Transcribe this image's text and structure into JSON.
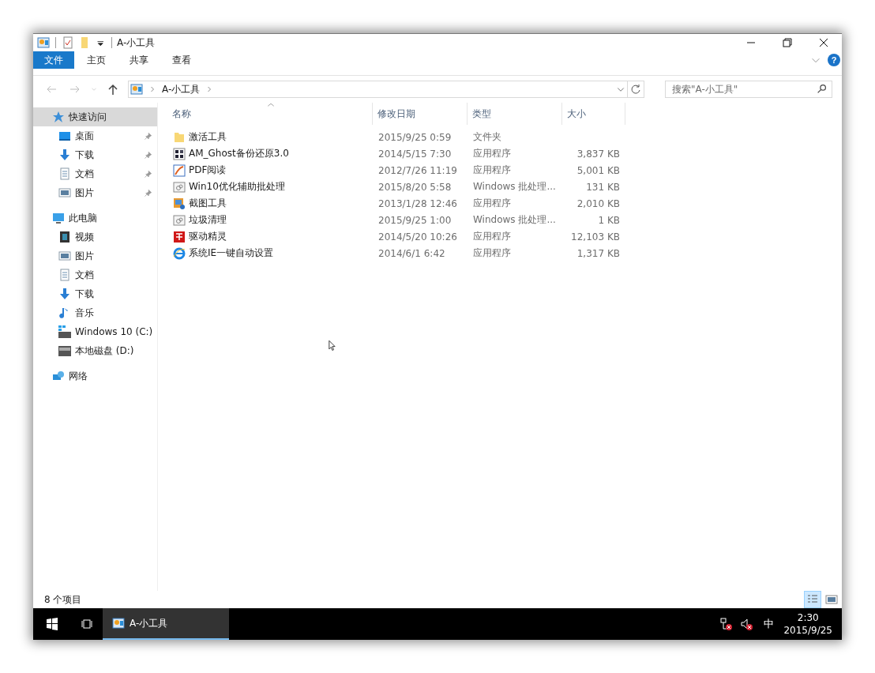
{
  "window": {
    "title": "A-小工具"
  },
  "ribbon_tabs": [
    {
      "label": "文件",
      "selected": true
    },
    {
      "label": "主页",
      "selected": false
    },
    {
      "label": "共享",
      "selected": false
    },
    {
      "label": "查看",
      "selected": false
    }
  ],
  "address": {
    "path": [
      "A-小工具"
    ]
  },
  "search": {
    "placeholder": "搜索\"A-小工具\""
  },
  "help": "?",
  "sidebar": {
    "items": [
      {
        "label": "快速访问",
        "kind": "star",
        "selected": true,
        "children": [
          {
            "label": "桌面",
            "kind": "desktop",
            "selected": false,
            "pinned": true
          },
          {
            "label": "下载",
            "kind": "download",
            "selected": false,
            "pinned": true
          },
          {
            "label": "文档",
            "kind": "document",
            "selected": false,
            "pinned": true
          },
          {
            "label": "图片",
            "kind": "picture",
            "selected": false,
            "pinned": true
          }
        ]
      },
      {
        "label": "此电脑",
        "kind": "pc",
        "selected": false,
        "children": [
          {
            "label": "视频",
            "kind": "video",
            "selected": false,
            "pinned": false
          },
          {
            "label": "图片",
            "kind": "picture",
            "selected": false,
            "pinned": false
          },
          {
            "label": "文档",
            "kind": "document",
            "selected": false,
            "pinned": false
          },
          {
            "label": "下载",
            "kind": "download",
            "selected": false,
            "pinned": false
          },
          {
            "label": "音乐",
            "kind": "music",
            "selected": false,
            "pinned": false
          },
          {
            "label": "Windows 10 (C:)",
            "kind": "drive-win",
            "selected": false,
            "pinned": false
          },
          {
            "label": "本地磁盘 (D:)",
            "kind": "drive",
            "selected": false,
            "pinned": false
          }
        ]
      },
      {
        "label": "网络",
        "kind": "network",
        "selected": false
      }
    ]
  },
  "table": {
    "columns": [
      {
        "label": "名称",
        "sorted": true
      },
      {
        "label": "修改日期",
        "sorted": false
      },
      {
        "label": "类型",
        "sorted": false
      },
      {
        "label": "大小",
        "sorted": false
      }
    ],
    "rows": [
      {
        "name": "激活工具",
        "kind": "folder",
        "date": "2015/9/25 0:59",
        "type": "文件夹",
        "size": ""
      },
      {
        "name": "AM_Ghost备份还原3.0",
        "kind": "grid-app",
        "date": "2014/5/15 7:30",
        "type": "应用程序",
        "size": "3,837 KB"
      },
      {
        "name": "PDF阅读",
        "kind": "pdf",
        "date": "2012/7/26 11:19",
        "type": "应用程序",
        "size": "5,001 KB"
      },
      {
        "name": "Win10优化辅助批处理",
        "kind": "batch",
        "date": "2015/8/20 5:58",
        "type": "Windows 批处理...",
        "size": "131 KB"
      },
      {
        "name": "截图工具",
        "kind": "screenshot",
        "date": "2013/1/28 12:46",
        "type": "应用程序",
        "size": "2,010 KB"
      },
      {
        "name": "垃圾清理",
        "kind": "batch",
        "date": "2015/9/25 1:00",
        "type": "Windows 批处理...",
        "size": "1 KB"
      },
      {
        "name": "驱动精灵",
        "kind": "red-app",
        "date": "2014/5/20 10:26",
        "type": "应用程序",
        "size": "12,103 KB"
      },
      {
        "name": "系统IE一键自动设置",
        "kind": "ie",
        "date": "2014/6/1 6:42",
        "type": "应用程序",
        "size": "1,317 KB"
      }
    ]
  },
  "status_bar": {
    "count": "8 个项目",
    "views": [
      {
        "kind": "details",
        "selected": true
      },
      {
        "kind": "large-icons",
        "selected": false
      }
    ]
  },
  "taskbar": {
    "apps": [
      {
        "label": "A-小工具",
        "selected": true
      }
    ],
    "ime": "中",
    "time": "2:30",
    "date": "2015/9/25"
  }
}
